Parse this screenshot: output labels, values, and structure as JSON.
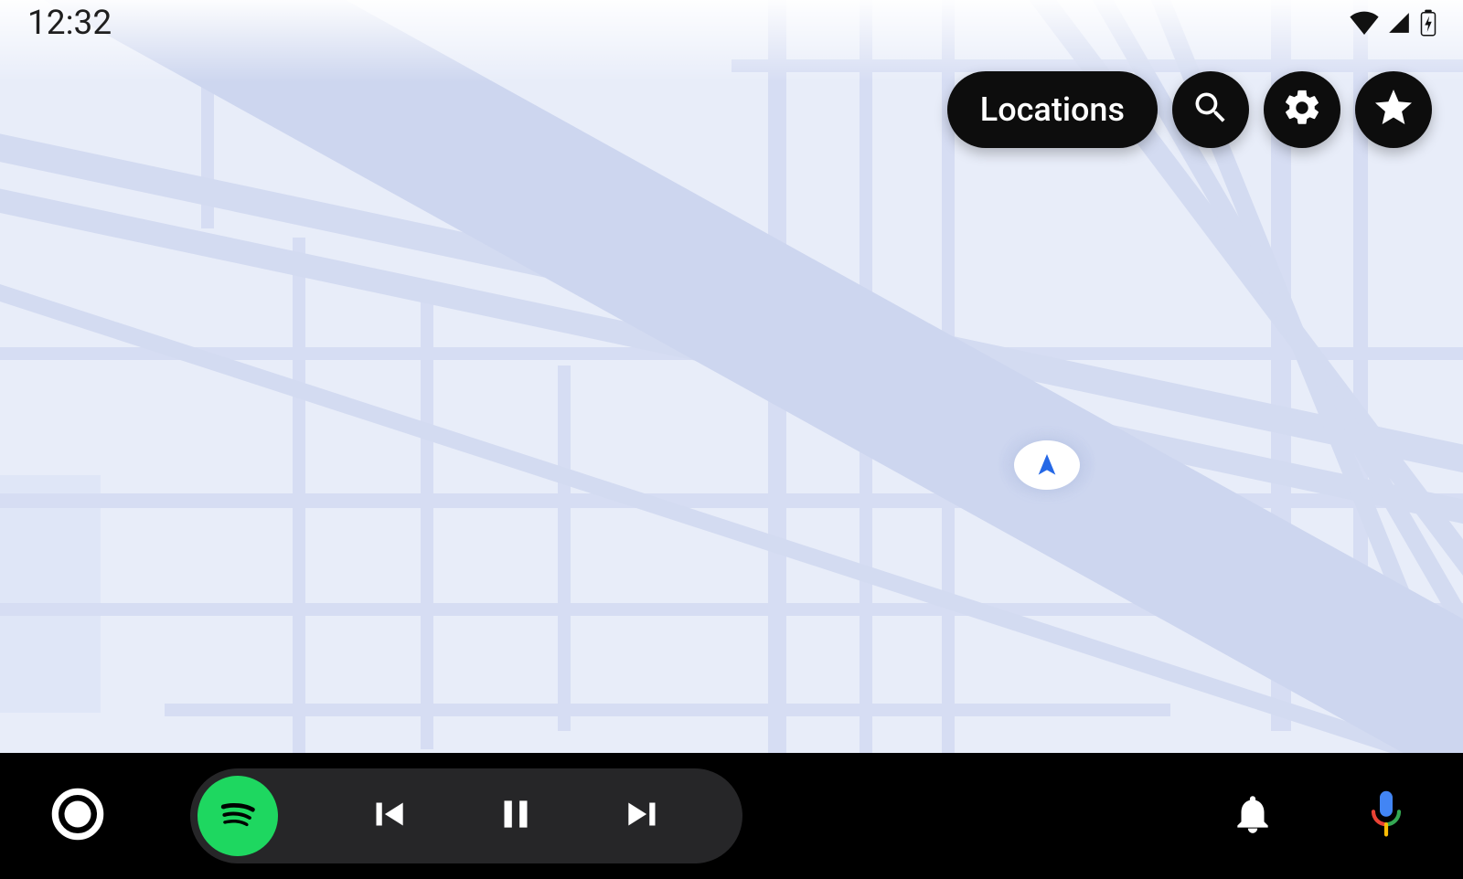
{
  "status": {
    "time": "12:32",
    "wifi_icon": "wifi-icon",
    "cell_icon": "cell-signal-icon",
    "battery_icon": "battery-charging-icon"
  },
  "actions": {
    "locations_label": "Locations",
    "search_icon": "search-icon",
    "settings_icon": "gear-icon",
    "star_icon": "star-icon"
  },
  "location_marker": {
    "icon": "current-location-arrow-icon"
  },
  "bottom": {
    "launcher_icon": "launcher-circle-icon",
    "app_icon": "spotify-icon",
    "prev_icon": "skip-previous-icon",
    "pause_icon": "pause-icon",
    "next_icon": "skip-next-icon",
    "notifications_icon": "bell-icon",
    "assistant_icon": "google-assistant-mic-icon"
  },
  "colors": {
    "spotify_green": "#1ed760",
    "assistant_blue": "#4285f4",
    "assistant_red": "#ea4335",
    "assistant_yellow": "#fbbc05",
    "assistant_green": "#34a853"
  }
}
